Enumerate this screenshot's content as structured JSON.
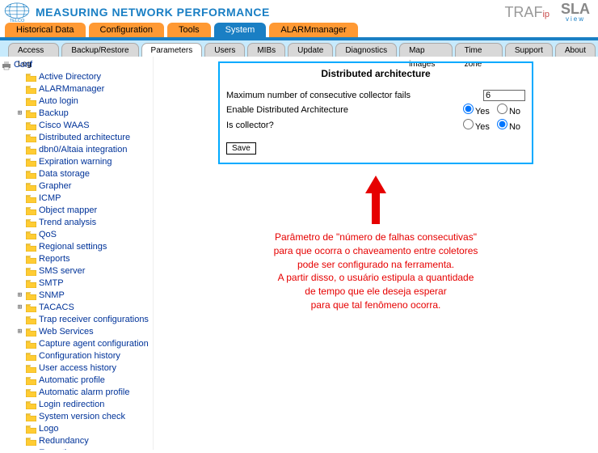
{
  "header": {
    "title": "MEASURING NETWORK PERFORMANCE",
    "logo_text": "TELCO",
    "brand1": "TRAF",
    "brand1_suffix": "ip",
    "brand2_main": "SLA",
    "brand2_sub": "view"
  },
  "tabs1": [
    {
      "label": "Historical Data",
      "active": false
    },
    {
      "label": "Configuration",
      "active": false
    },
    {
      "label": "Tools",
      "active": false
    },
    {
      "label": "System",
      "active": true
    },
    {
      "label": "ALARMmanager",
      "active": false
    }
  ],
  "tabs2": [
    {
      "label": "Access Log",
      "active": false
    },
    {
      "label": "Backup/Restore",
      "active": false
    },
    {
      "label": "Parameters",
      "active": true
    },
    {
      "label": "Users",
      "active": false
    },
    {
      "label": "MIBs",
      "active": false
    },
    {
      "label": "Update",
      "active": false
    },
    {
      "label": "Diagnostics",
      "active": false
    },
    {
      "label": "Map images",
      "active": false
    },
    {
      "label": "Time zone",
      "active": false
    },
    {
      "label": "Support",
      "active": false
    },
    {
      "label": "About",
      "active": false
    }
  ],
  "tree": {
    "root_label": "Conf",
    "items": [
      {
        "label": "Active Directory",
        "expandable": false,
        "level": 1
      },
      {
        "label": "ALARMmanager",
        "expandable": false,
        "level": 1
      },
      {
        "label": "Auto login",
        "expandable": false,
        "level": 1
      },
      {
        "label": "Backup",
        "expandable": true,
        "level": 1
      },
      {
        "label": "Cisco WAAS",
        "expandable": false,
        "level": 1
      },
      {
        "label": "Distributed architecture",
        "expandable": false,
        "level": 1
      },
      {
        "label": "dbn0/Altaia integration",
        "expandable": false,
        "level": 1
      },
      {
        "label": "Expiration warning",
        "expandable": false,
        "level": 1
      },
      {
        "label": "Data storage",
        "expandable": false,
        "level": 1
      },
      {
        "label": "Grapher",
        "expandable": false,
        "level": 1
      },
      {
        "label": "ICMP",
        "expandable": false,
        "level": 1
      },
      {
        "label": "Object mapper",
        "expandable": false,
        "level": 1
      },
      {
        "label": "Trend analysis",
        "expandable": false,
        "level": 1
      },
      {
        "label": "QoS",
        "expandable": false,
        "level": 1
      },
      {
        "label": "Regional settings",
        "expandable": false,
        "level": 1
      },
      {
        "label": "Reports",
        "expandable": false,
        "level": 1
      },
      {
        "label": "SMS server",
        "expandable": false,
        "level": 1
      },
      {
        "label": "SMTP",
        "expandable": false,
        "level": 1
      },
      {
        "label": "SNMP",
        "expandable": true,
        "level": 1
      },
      {
        "label": "TACACS",
        "expandable": true,
        "level": 1
      },
      {
        "label": "Trap receiver configurations",
        "expandable": false,
        "level": 1
      },
      {
        "label": "Web Services",
        "expandable": true,
        "level": 1
      },
      {
        "label": "Capture agent configuration",
        "expandable": false,
        "level": 1
      },
      {
        "label": "Configuration history",
        "expandable": false,
        "level": 1
      },
      {
        "label": "User access history",
        "expandable": false,
        "level": 1
      },
      {
        "label": "Automatic profile",
        "expandable": false,
        "level": 1
      },
      {
        "label": "Automatic alarm profile",
        "expandable": false,
        "level": 1
      },
      {
        "label": "Login redirection",
        "expandable": false,
        "level": 1
      },
      {
        "label": "System version check",
        "expandable": false,
        "level": 1
      },
      {
        "label": "Logo",
        "expandable": false,
        "level": 1
      },
      {
        "label": "Redundancy",
        "expandable": false,
        "level": 1
      },
      {
        "label": "Exporting",
        "expandable": true,
        "level": 1
      }
    ]
  },
  "panel": {
    "title": "Distributed architecture",
    "rows": [
      {
        "label": "Maximum number of consecutive collector fails",
        "type": "text",
        "value": "6"
      },
      {
        "label": "Enable Distributed Architecture",
        "type": "yesno",
        "yes": "Yes",
        "no": "No",
        "value": "yes"
      },
      {
        "label": "Is collector?",
        "type": "yesno",
        "yes": "Yes",
        "no": "No",
        "value": "no"
      }
    ],
    "save": "Save"
  },
  "annotation": {
    "l1": "Parâmetro de \"número de falhas consecutivas\"",
    "l2": "para que ocorra o chaveamento entre coletores",
    "l3": "pode ser configurado na ferramenta.",
    "l4": "A partir disso, o usuário estipula a quantidade",
    "l5": "de tempo que ele deseja esperar",
    "l6": "para que tal fenômeno ocorra."
  }
}
